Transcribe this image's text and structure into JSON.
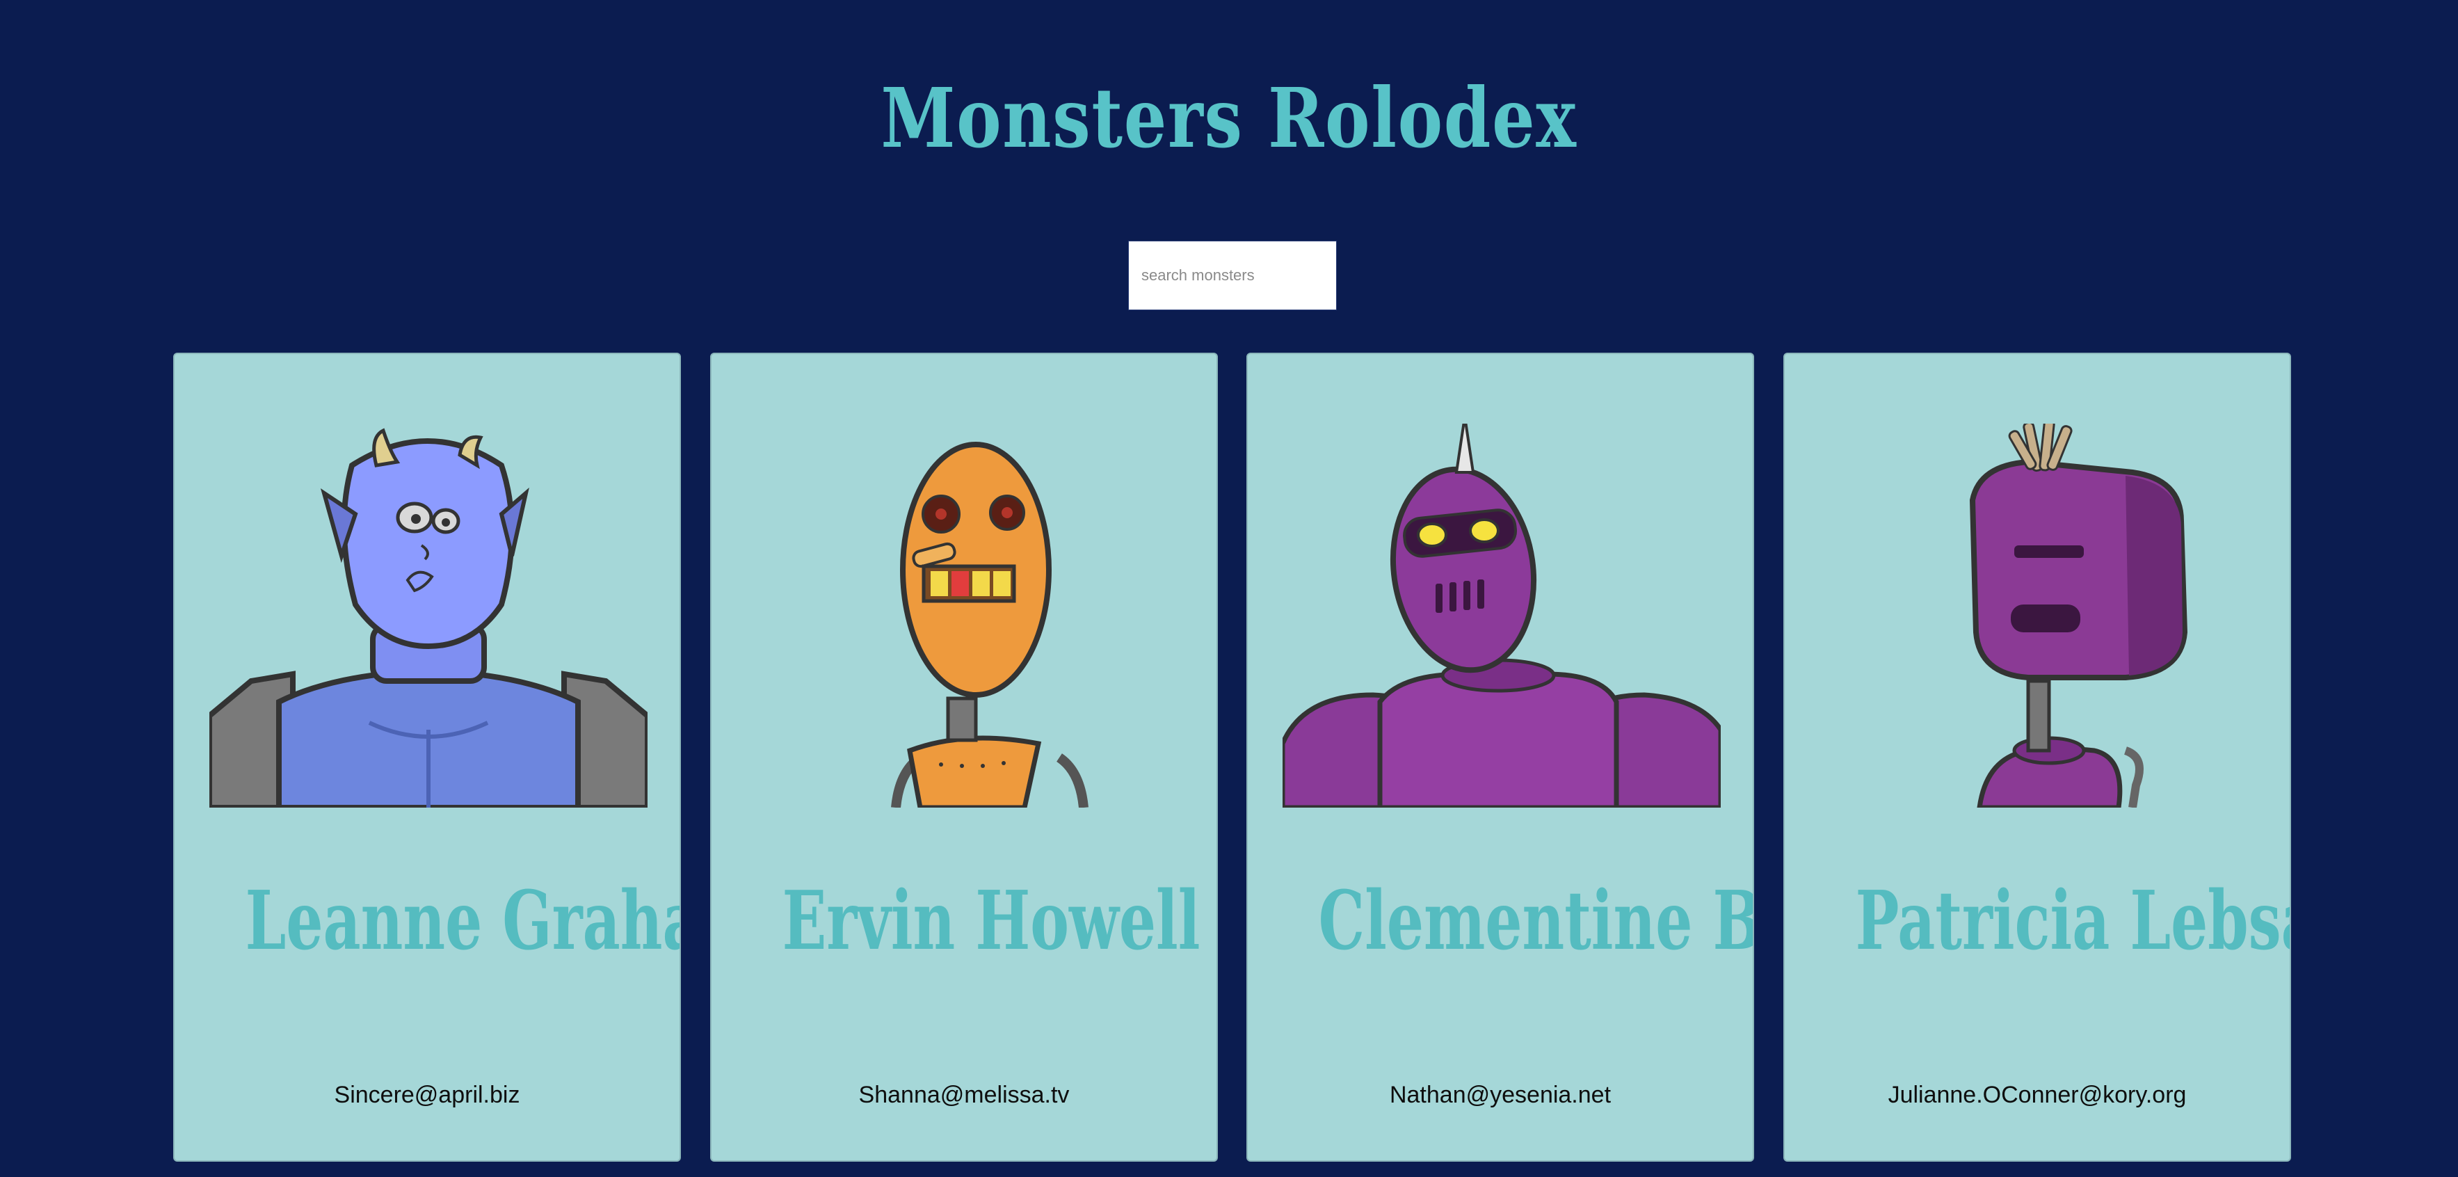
{
  "header": {
    "title": "Monsters Rolodex"
  },
  "search": {
    "placeholder": "search monsters",
    "value": ""
  },
  "cards": [
    {
      "name": "Leanne Graham",
      "email": "Sincere@april.biz",
      "avatar_icon": "blue-horned-monster-icon",
      "color": "#7f8ff2"
    },
    {
      "name": "Ervin Howell",
      "email": "Shanna@melissa.tv",
      "avatar_icon": "orange-robot-icon",
      "color": "#ee9a3d"
    },
    {
      "name": "Clementine Bauch",
      "email": "Nathan@yesenia.net",
      "avatar_icon": "purple-spiked-robot-icon",
      "color": "#8a3a98"
    },
    {
      "name": "Patricia Lebsack",
      "email": "Julianne.OConner@kory.org",
      "avatar_icon": "purple-box-robot-icon",
      "color": "#8b3a95"
    }
  ],
  "colors": {
    "background": "#0b1c50",
    "card": "#a5d7d8",
    "accent": "#58c3c8"
  }
}
